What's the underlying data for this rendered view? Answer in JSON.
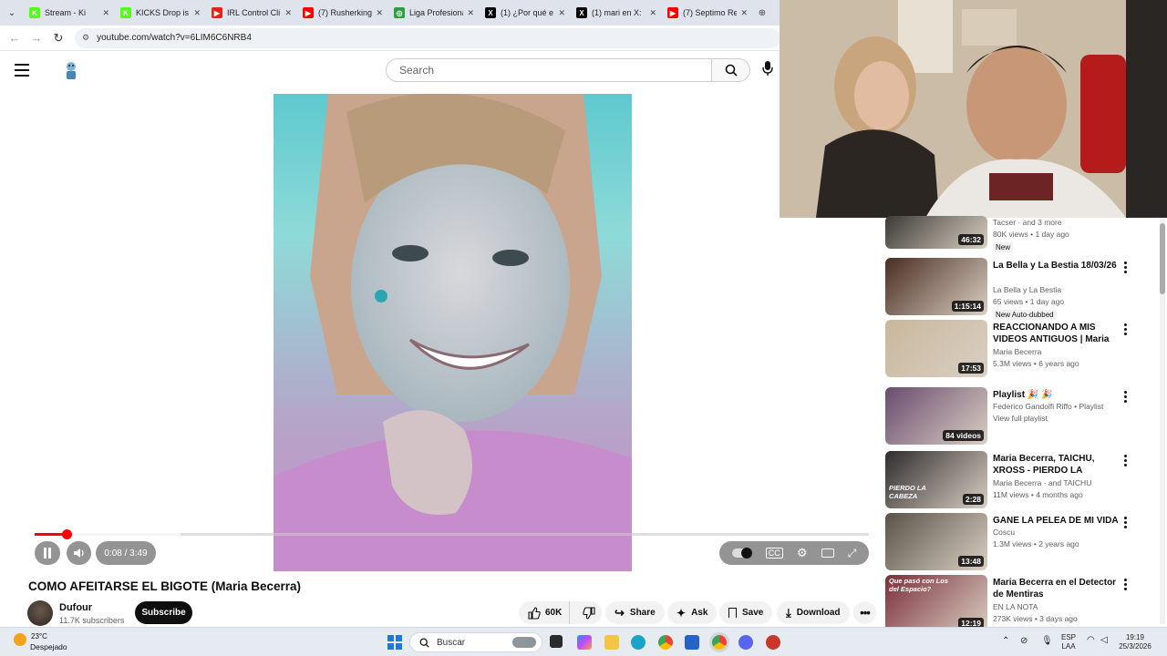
{
  "browser": {
    "tabs": [
      {
        "label": "Stream - Ki",
        "fav_color": "#53fc18",
        "fav_text": "K"
      },
      {
        "label": "KICKS Drop is",
        "fav_color": "#53fc18",
        "fav_text": "K"
      },
      {
        "label": "IRL Control Cli",
        "fav_color": "#e62117",
        "fav_text": "▶"
      },
      {
        "label": "(7) Rusherking",
        "fav_color": "#ff0000",
        "fav_text": "▶"
      },
      {
        "label": "Liga Profesional",
        "fav_color": "#2e9e44",
        "fav_text": "◎"
      },
      {
        "label": "(1) ¿Por qué e",
        "fav_color": "#000000",
        "fav_text": "X"
      },
      {
        "label": "(1) mari en X:",
        "fav_color": "#000000",
        "fav_text": "X"
      },
      {
        "label": "(7) Septimo Re",
        "fav_color": "#ff0000",
        "fav_text": "▶"
      }
    ],
    "url": "youtube.com/watch?v=6LIM6C6NRB4"
  },
  "header": {
    "search_placeholder": "Search"
  },
  "player": {
    "time_label": "0:08 / 3:49",
    "progress": 0.038,
    "buffer": 0.175
  },
  "video": {
    "title": "COMO AFEITARSE EL BIGOTE (Maria Becerra)",
    "channel": "Dufour",
    "subscribers": "11.7K subscribers",
    "subscribe_label": "Subscribe",
    "likes": "60K",
    "share_label": "Share",
    "ask_label": "Ask",
    "save_label": "Save",
    "download_label": "Download"
  },
  "recommendations": [
    {
      "title": "",
      "channel": "Tacser · and 3 more",
      "meta": "80K views • 1 day ago",
      "badge": "New",
      "duration": "46:32",
      "thumb": "#3c3a36"
    },
    {
      "title": "La Bella y La Bestia 18/03/26",
      "channel": "La Bella y La Bestia",
      "meta": "65 views • 1 day ago",
      "badge": "New   Auto-dubbed",
      "duration": "1:15:14",
      "thumb": "#4a2c22"
    },
    {
      "title": "REACCIONANDO A MIS VIDEOS ANTIGUOS | Maria Becerra",
      "channel": "Maria Becerra",
      "meta": "5.3M views • 6 years ago",
      "badge": "",
      "duration": "17:53",
      "thumb": "#c9b79c"
    },
    {
      "title": "Playlist 🎉 🎉",
      "channel": "Federico Gandolfi Riffo • Playlist",
      "meta": "View full playlist",
      "badge": "",
      "duration": "84 videos",
      "thumb": "#6a4b6e"
    },
    {
      "title": "Maria Becerra, TAICHU, XROSS - PIERDO LA CABEZA | MARIA:...",
      "channel": "Maria Becerra · and TAICHU",
      "meta": "11M views • 4 months ago",
      "badge": "",
      "duration": "2:28",
      "thumb": "#2f2b2e"
    },
    {
      "title": "GANE LA PELEA DE MI VIDA",
      "channel": "Coscu",
      "meta": "1.3M views • 2 years ago",
      "badge": "",
      "duration": "13:48",
      "thumb": "#5a5148"
    },
    {
      "title": "Maria Becerra en el Detector de Mentiras",
      "channel": "EN LA NOTA",
      "meta": "273K views • 3 days ago",
      "badge": "",
      "duration": "12:19",
      "thumb": "#7a2e3a"
    }
  ],
  "rec_overlay_text": {
    "thumb4_caption": "PIERDO LA CABEZA",
    "thumb7_caption": "Que pasó con Los del Espacio?"
  },
  "taskbar": {
    "weather_temp": "23°C",
    "weather_desc": "Despejado",
    "search_label": "Buscar",
    "lang_1": "ESP",
    "lang_2": "LAA",
    "time": "19:19",
    "date": "25/3/2026"
  }
}
